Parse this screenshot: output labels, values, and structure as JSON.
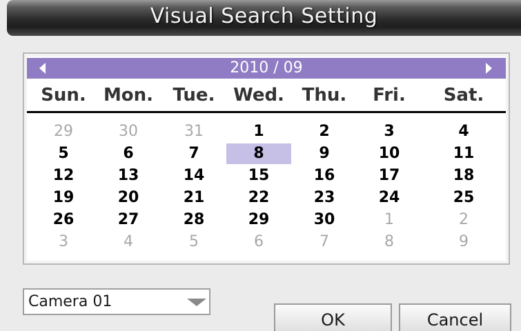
{
  "dialog": {
    "title": "Visual Search Setting"
  },
  "calendar": {
    "month_label": "2010 / 09",
    "weekdays": [
      "Sun.",
      "Mon.",
      "Tue.",
      "Wed.",
      "Thu.",
      "Fri.",
      "Sat."
    ],
    "weeks": [
      [
        {
          "d": "29",
          "other": true
        },
        {
          "d": "30",
          "other": true
        },
        {
          "d": "31",
          "other": true
        },
        {
          "d": "1"
        },
        {
          "d": "2"
        },
        {
          "d": "3"
        },
        {
          "d": "4"
        }
      ],
      [
        {
          "d": "5"
        },
        {
          "d": "6"
        },
        {
          "d": "7"
        },
        {
          "d": "8",
          "selected": true
        },
        {
          "d": "9"
        },
        {
          "d": "10"
        },
        {
          "d": "11"
        }
      ],
      [
        {
          "d": "12"
        },
        {
          "d": "13"
        },
        {
          "d": "14"
        },
        {
          "d": "15"
        },
        {
          "d": "16"
        },
        {
          "d": "17"
        },
        {
          "d": "18"
        }
      ],
      [
        {
          "d": "19"
        },
        {
          "d": "20"
        },
        {
          "d": "21"
        },
        {
          "d": "22"
        },
        {
          "d": "23"
        },
        {
          "d": "24"
        },
        {
          "d": "25"
        }
      ],
      [
        {
          "d": "26"
        },
        {
          "d": "27"
        },
        {
          "d": "28"
        },
        {
          "d": "29"
        },
        {
          "d": "30"
        },
        {
          "d": "1",
          "other": true
        },
        {
          "d": "2",
          "other": true
        }
      ],
      [
        {
          "d": "3",
          "other": true
        },
        {
          "d": "4",
          "other": true
        },
        {
          "d": "5",
          "other": true
        },
        {
          "d": "6",
          "other": true
        },
        {
          "d": "7",
          "other": true
        },
        {
          "d": "8",
          "other": true
        },
        {
          "d": "9",
          "other": true
        }
      ]
    ],
    "header_color": "#8f7cc4",
    "selected_color": "#c6bfe6"
  },
  "camera_select": {
    "value": "Camera 01"
  },
  "buttons": {
    "ok_label": "OK",
    "cancel_label": "Cancel"
  }
}
